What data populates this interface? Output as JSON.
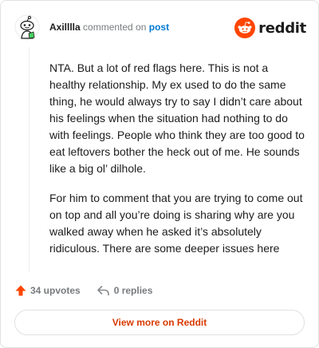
{
  "comment": {
    "author": "Axilllla",
    "commented_on_text": "commented on",
    "post_link_text": "post",
    "paragraphs": [
      "NTA. But a lot of red flags here. This is not a healthy relationship. My ex used to do the same thing, he would always try to say I didn’t care about his feelings when the situation had nothing to do with feelings. People who think they are too good to eat leftovers bother the heck out of me. He sounds like a big ol’ dilhole.",
      "For him to comment that you are trying to come out on top and all you’re doing is sharing why are you walked away when he asked it’s absolutely ridiculous. There are some deeper issues here"
    ],
    "upvotes_label": "34 upvotes",
    "replies_label": "0 replies"
  },
  "brand": {
    "wordmark": "reddit",
    "accent_color": "#ff4500",
    "link_color": "#0079d3",
    "button_text_color": "#d93a00"
  },
  "footer": {
    "view_more_label": "View more on Reddit"
  },
  "icons": {
    "avatar": "snoo-avatar-icon",
    "logo": "reddit-alien-icon",
    "upvote": "upvote-arrow-icon",
    "reply": "reply-arrow-icon"
  }
}
